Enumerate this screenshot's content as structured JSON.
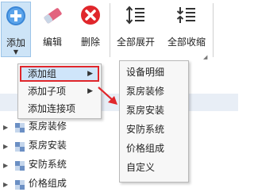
{
  "ribbon": {
    "buttons": [
      {
        "label": "添加",
        "icon": "plus-circle-icon"
      },
      {
        "label": "编辑",
        "icon": "eraser-icon"
      },
      {
        "label": "删除",
        "icon": "delete-x-icon"
      },
      {
        "label": "全部展开",
        "icon": "expand-all-icon"
      },
      {
        "label": "全部收缩",
        "icon": "collapse-all-icon"
      }
    ]
  },
  "tree": {
    "rows": [
      "泵房装修",
      "泵房安装",
      "安防系统",
      "价格组成"
    ]
  },
  "menu": {
    "items": [
      {
        "label": "添加组",
        "has_submenu": true
      },
      {
        "label": "添加子项",
        "has_submenu": true
      },
      {
        "label": "添加连接项",
        "has_submenu": false
      }
    ]
  },
  "submenu": {
    "items": [
      "设备明细",
      "泵房装修",
      "泵房安装",
      "安防系统",
      "价格组成",
      "自定义"
    ]
  },
  "colors": {
    "highlight_border": "#e0262b",
    "menu_selected_bg": "#cfe5fa",
    "add_button_bg": "#cde4f7"
  }
}
